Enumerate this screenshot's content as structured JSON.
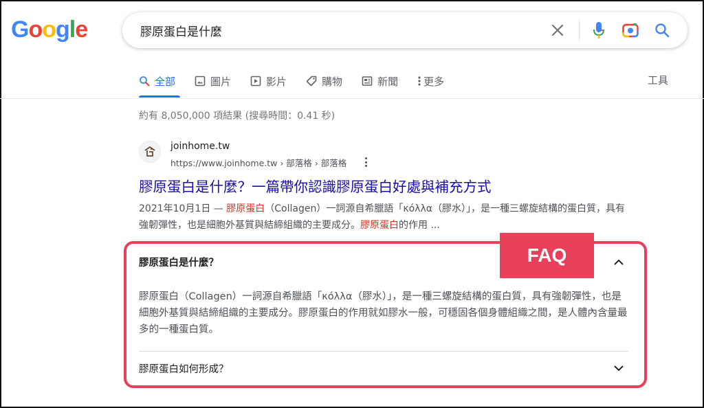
{
  "logo": {
    "letters": [
      "G",
      "o",
      "o",
      "g",
      "l",
      "e"
    ],
    "colors": [
      "#4285f4",
      "#ea4335",
      "#fbbc05",
      "#4285f4",
      "#34a853",
      "#ea4335"
    ]
  },
  "search": {
    "query": "膠原蛋白是什麼"
  },
  "tabs": [
    {
      "label": "全部",
      "icon": "search-icon"
    },
    {
      "label": "圖片",
      "icon": "image-icon"
    },
    {
      "label": "影片",
      "icon": "video-icon"
    },
    {
      "label": "購物",
      "icon": "tag-icon"
    },
    {
      "label": "新聞",
      "icon": "news-icon"
    },
    {
      "label": "更多",
      "icon": "more-vert-icon"
    }
  ],
  "tools_label": "工具",
  "stats": "約有 8,050,000 項結果 (搜尋時間：0.41 秒)",
  "result": {
    "site_name": "joinhome.tw",
    "url": "https://www.joinhome.tw › 部落格 › 部落格",
    "title": "膠原蛋白是什麼？一篇帶你認識膠原蛋白好處與補充方式",
    "snippet": {
      "date": "2021年10月1日 — ",
      "hl1": "膠原蛋白",
      "part1": "（Collagen）一詞源自希臘語「κόλλα（膠水）」，是一種三螺旋結構的蛋白質，具有強韌彈性，也是細胞外基質與結締組織的主要成分。",
      "hl2": "膠原蛋白",
      "part2": "的作用 ..."
    }
  },
  "faq": {
    "badge": "FAQ",
    "q1": "膠原蛋白是什麼？",
    "a1": "膠原蛋白（Collagen）一詞源自希臘語「κόλλα（膠水）」，是一種三螺旋結構的蛋白質，具有強韌彈性，也是細胞外基質與結締組織的主要成分。膠原蛋白的作用就如膠水一般，可穩固各個身體組織之間，是人體內含量最多的一種蛋白質。",
    "q2": "膠原蛋白如何形成？"
  },
  "colors": {
    "accent": "#1a73e8",
    "link": "#1a0dab",
    "highlight": "#d93025",
    "faq_frame": "#e8405b"
  }
}
